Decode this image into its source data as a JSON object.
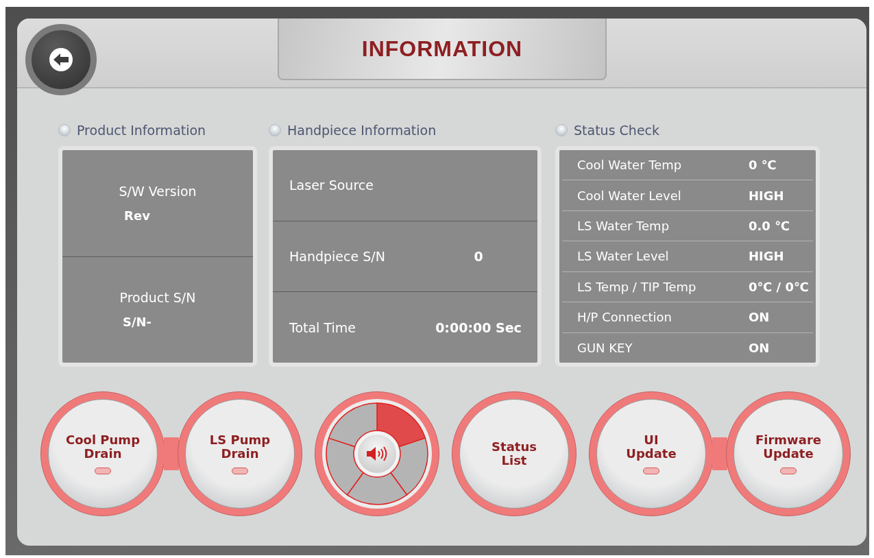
{
  "title": "INFORMATION",
  "product": {
    "heading": "Product Information",
    "items": [
      {
        "label": "S/W Version",
        "value": "Rev"
      },
      {
        "label": "Product S/N",
        "value": "S/N-"
      }
    ]
  },
  "handpiece": {
    "heading": "Handpiece Information",
    "rows": [
      {
        "label": "Laser Source"
      },
      {
        "label": "Handpiece S/N",
        "value": "0"
      },
      {
        "label": "Total Time",
        "value": "0:00:00 Sec"
      }
    ]
  },
  "status": {
    "heading": "Status Check",
    "rows": [
      {
        "label": "Cool Water Temp",
        "value": "0 ℃"
      },
      {
        "label": "Cool Water Level",
        "value": "HIGH"
      },
      {
        "label": "LS Water Temp",
        "value": "0.0 ℃"
      },
      {
        "label": "LS Water Level",
        "value": "HIGH"
      },
      {
        "label": "LS Temp / TIP Temp",
        "value": "0℃ / 0℃"
      },
      {
        "label": "H/P Connection",
        "value": "ON"
      },
      {
        "label": "GUN KEY",
        "value": "ON"
      }
    ]
  },
  "controls": [
    {
      "kind": "pair",
      "buttons": [
        {
          "label_lines": [
            "Cool Pump",
            "Drain"
          ],
          "indicator": true
        },
        {
          "label_lines": [
            "LS Pump",
            "Drain"
          ],
          "indicator": true
        }
      ]
    },
    {
      "kind": "volume",
      "segments": [
        {
          "on": true
        },
        {
          "on": false
        },
        {
          "on": false
        },
        {
          "on": false
        },
        {
          "on": false
        }
      ]
    },
    {
      "kind": "single",
      "buttons": [
        {
          "label_lines": [
            "Status",
            "List"
          ],
          "indicator": false
        }
      ]
    },
    {
      "kind": "pair",
      "buttons": [
        {
          "label_lines": [
            "UI",
            "Update"
          ],
          "indicator": true
        },
        {
          "label_lines": [
            "Firmware",
            "Update"
          ],
          "indicator": true
        }
      ]
    }
  ]
}
